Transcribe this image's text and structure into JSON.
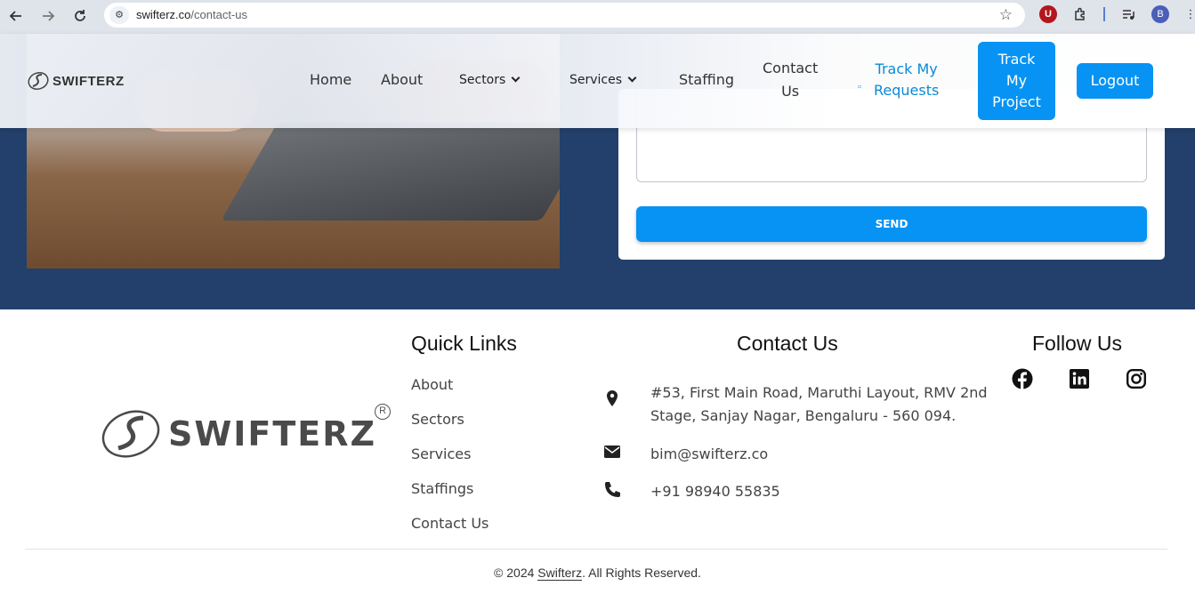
{
  "browser": {
    "url_host": "swifterz.co",
    "url_path": "/contact-us",
    "profile_initial": "B",
    "extension_u": "U",
    "icons": [
      "back-arrow-icon",
      "forward-arrow-icon",
      "reload-icon",
      "site-info-icon",
      "star-icon",
      "puzzle-icon",
      "media-icon",
      "kebab-menu-icon"
    ]
  },
  "header": {
    "logo_text": "SWIFTERZ",
    "nav": {
      "home": "Home",
      "about": "About",
      "sectors": "Sectors",
      "services": "Services",
      "staffing": "Staffing",
      "contact_line1": "Contact",
      "contact_line2": "Us",
      "track_requests_line1": "Track My",
      "track_requests_line2": "Requests",
      "track_project_line1": "Track",
      "track_project_line2": "My",
      "track_project_line3": "Project",
      "logout": "Logout"
    },
    "accent_color": "#0693f3"
  },
  "form": {
    "send_label": "SEND"
  },
  "footer": {
    "logo_text": "SWIFTERZ",
    "logo_reg": "R",
    "quick_links_title": "Quick Links",
    "quick_links": [
      "About",
      "Sectors",
      "Services",
      "Staffings",
      "Contact Us"
    ],
    "contact_title": "Contact Us",
    "address_line1": "#53, First Main Road, Maruthi Layout, RMV 2nd",
    "address_line2": "Stage, Sanjay Nagar, Bengaluru - 560 094.",
    "email": "bim@swifterz.co",
    "phone": "+91 98940 55835",
    "follow_title": "Follow Us",
    "social_icons": [
      "facebook-icon",
      "linkedin-icon",
      "instagram-icon"
    ],
    "copyright_prefix": "© 2024 ",
    "copyright_brand": "Swifterz",
    "copyright_suffix": ". All Rights Reserved."
  },
  "colors": {
    "hero_bg": "#22406b",
    "button": "#0693f3",
    "link": "#0a8ad6"
  }
}
